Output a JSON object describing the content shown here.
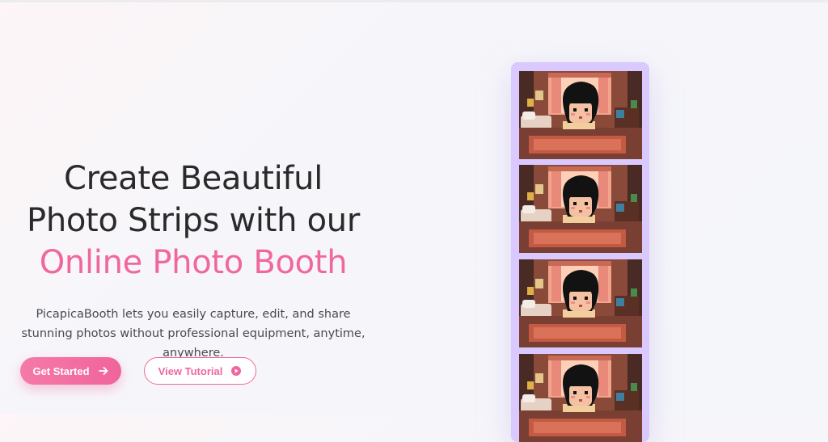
{
  "hero": {
    "headline_line1": "Create Beautiful",
    "headline_line2": "Photo Strips with our",
    "headline_accent": "Online Photo Booth",
    "subtext": "PicapicaBooth lets you easily capture, edit, and share stunning photos without professional equipment, anytime, anywhere.",
    "primary_button": "Get Started",
    "secondary_button": "View Tutorial"
  },
  "icons": {
    "primary_button_icon": "arrow-right-icon",
    "secondary_button_icon": "play-circle-icon"
  },
  "colors": {
    "accent": "#f0679e",
    "strip": "#d9c9ff",
    "heading": "#2a2a2a"
  }
}
